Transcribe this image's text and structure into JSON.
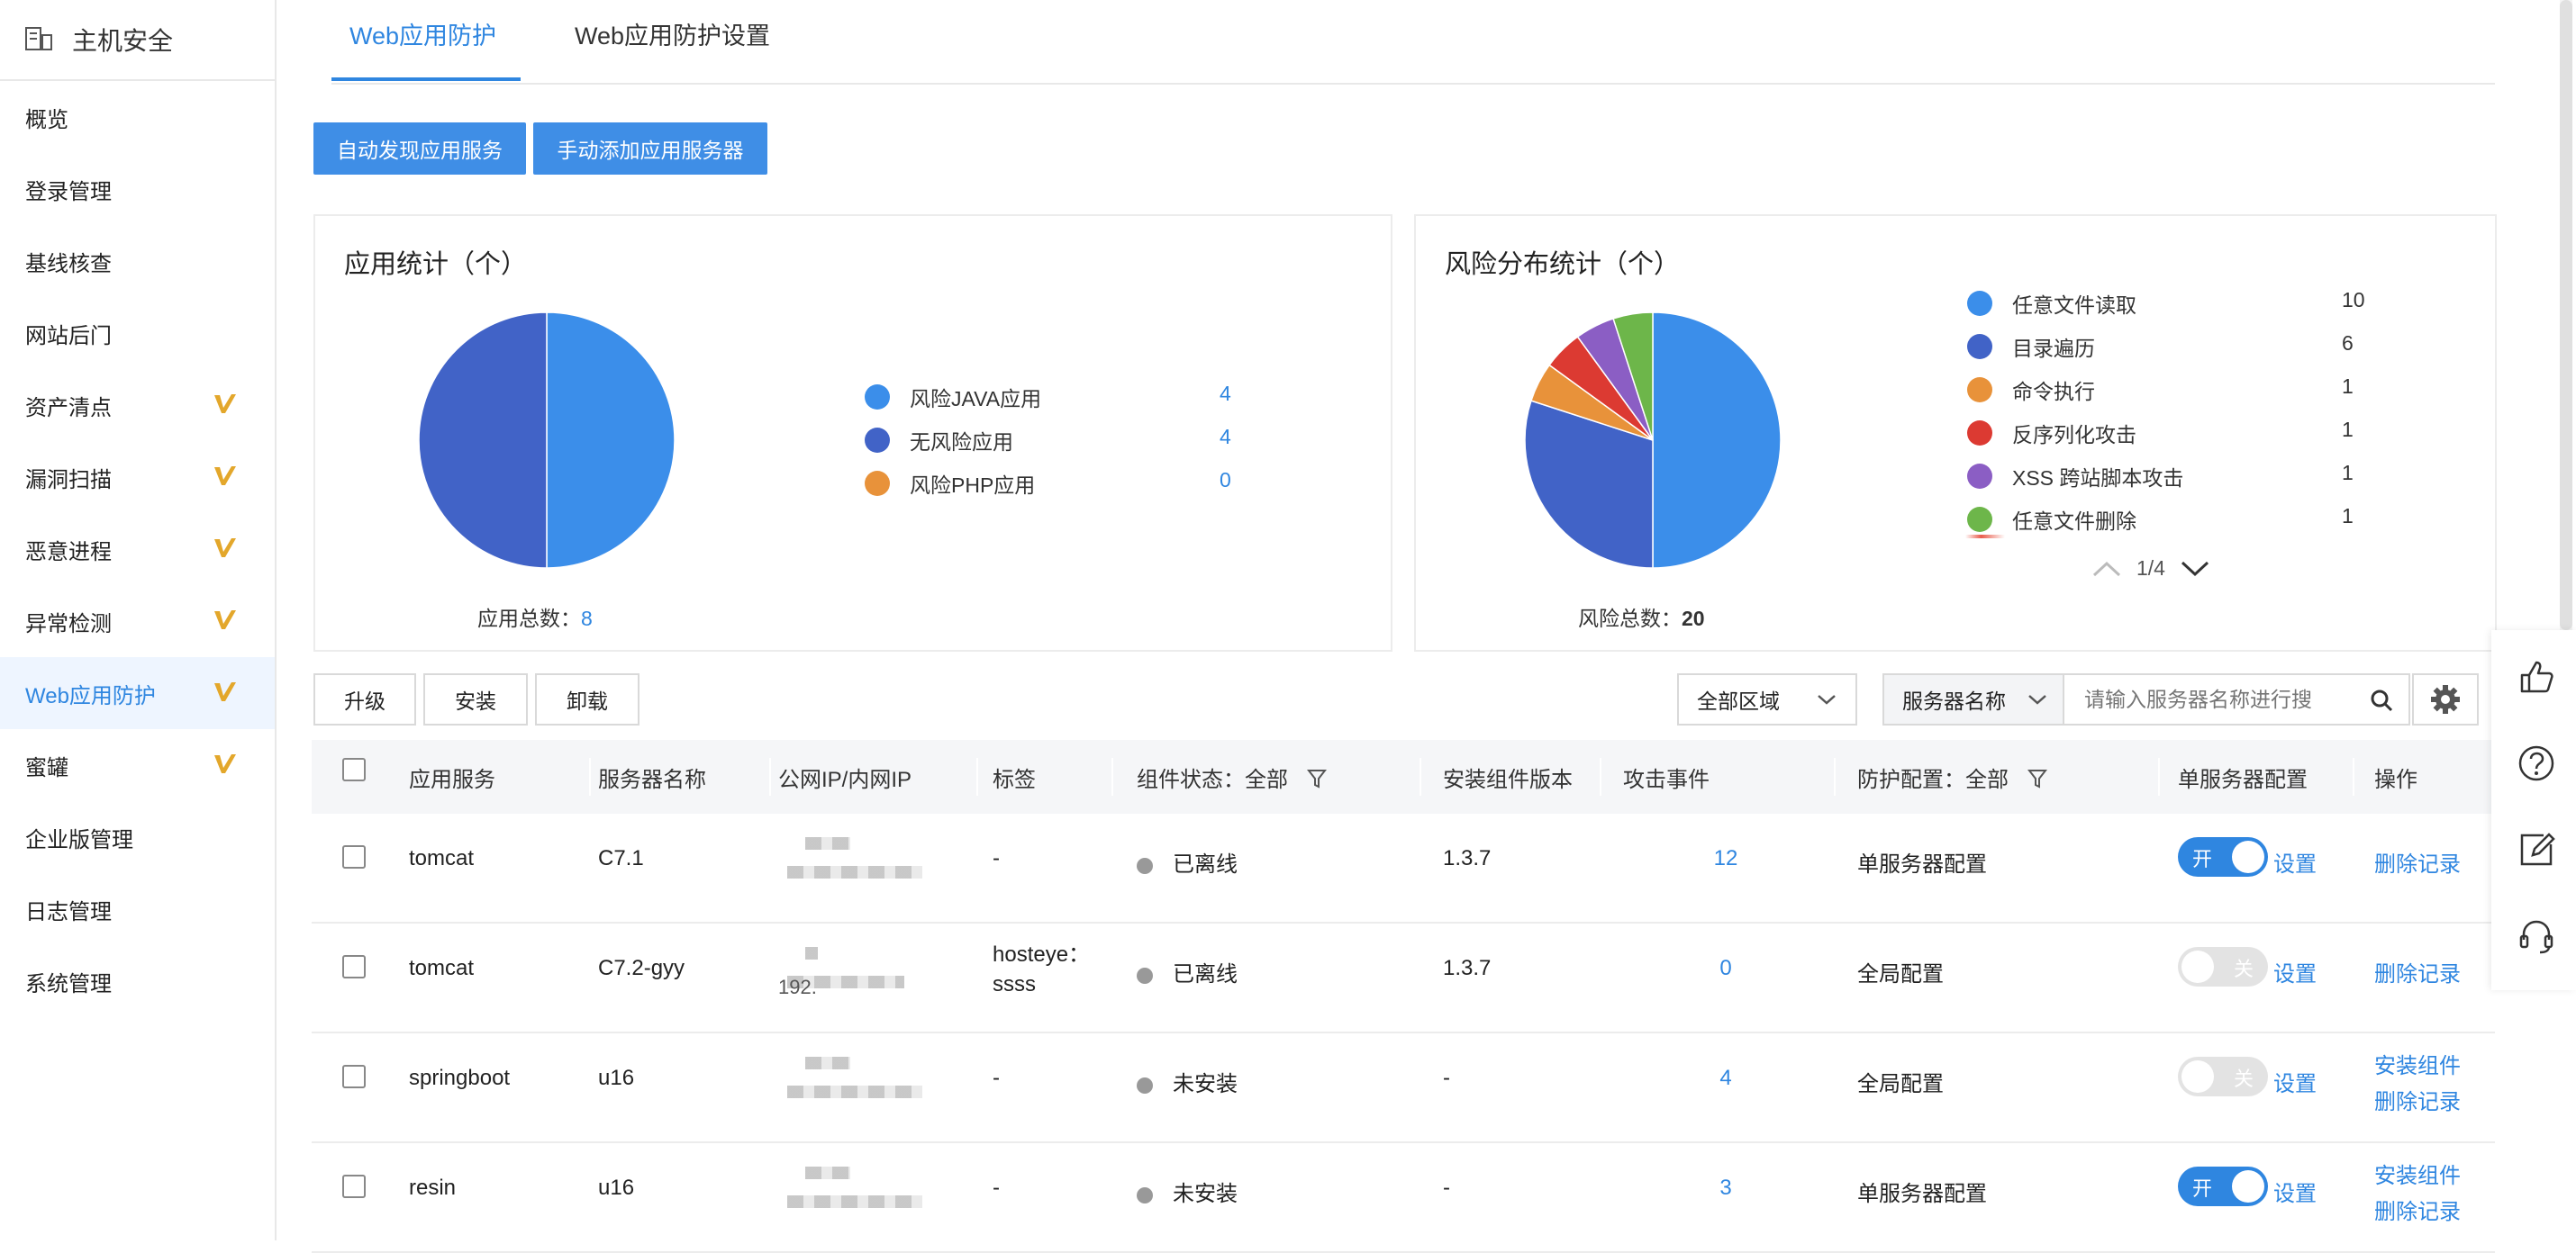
{
  "sidebar": {
    "title": "主机安全",
    "items": [
      {
        "label": "概览",
        "badge": false,
        "active": false
      },
      {
        "label": "登录管理",
        "badge": false,
        "active": false
      },
      {
        "label": "基线核查",
        "badge": false,
        "active": false
      },
      {
        "label": "网站后门",
        "badge": false,
        "active": false
      },
      {
        "label": "资产清点",
        "badge": true,
        "active": false
      },
      {
        "label": "漏洞扫描",
        "badge": true,
        "active": false
      },
      {
        "label": "恶意进程",
        "badge": true,
        "active": false
      },
      {
        "label": "异常检测",
        "badge": true,
        "active": false
      },
      {
        "label": "Web应用防护",
        "badge": true,
        "active": true
      },
      {
        "label": "蜜罐",
        "badge": true,
        "active": false
      },
      {
        "label": "企业版管理",
        "badge": false,
        "active": false
      },
      {
        "label": "日志管理",
        "badge": false,
        "active": false
      },
      {
        "label": "系统管理",
        "badge": false,
        "active": false
      }
    ]
  },
  "tabs": [
    "Web应用防护",
    "Web应用防护设置"
  ],
  "actions": {
    "auto_discover": "自动发现应用服务",
    "manual_add": "手动添加应用服务器"
  },
  "app_stats": {
    "title": "应用统计（个）",
    "total_label": "应用总数：",
    "total": "8",
    "legend": [
      {
        "label": "风险JAVA应用",
        "value": "4",
        "color": "#3b8eea"
      },
      {
        "label": "无风险应用",
        "value": "4",
        "color": "#4163c7"
      },
      {
        "label": "风险PHP应用",
        "value": "0",
        "color": "#e8923a"
      }
    ]
  },
  "risk_stats": {
    "title": "风险分布统计（个）",
    "total_label": "风险总数：",
    "total": "20",
    "legend": [
      {
        "label": "任意文件读取",
        "value": "10",
        "color": "#3b8eea"
      },
      {
        "label": "目录遍历",
        "value": "6",
        "color": "#4163c7"
      },
      {
        "label": "命令执行",
        "value": "1",
        "color": "#e8923a"
      },
      {
        "label": "反序列化攻击",
        "value": "1",
        "color": "#dc3a32"
      },
      {
        "label": "XSS 跨站脚本攻击",
        "value": "1",
        "color": "#8b5ec4"
      },
      {
        "label": "任意文件删除",
        "value": "1",
        "color": "#6db64a"
      }
    ],
    "page": "1/4"
  },
  "chart_data": [
    {
      "type": "pie",
      "title": "应用统计（个）",
      "categories": [
        "风险JAVA应用",
        "无风险应用",
        "风险PHP应用"
      ],
      "values": [
        4,
        4,
        0
      ],
      "colors": [
        "#3b8eea",
        "#4163c7",
        "#e8923a"
      ]
    },
    {
      "type": "pie",
      "title": "风险分布统计（个）",
      "categories": [
        "任意文件读取",
        "目录遍历",
        "命令执行",
        "反序列化攻击",
        "XSS 跨站脚本攻击",
        "任意文件删除"
      ],
      "values": [
        10,
        6,
        1,
        1,
        1,
        1
      ],
      "colors": [
        "#3b8eea",
        "#4163c7",
        "#e8923a",
        "#dc3a32",
        "#8b5ec4",
        "#6db64a"
      ]
    }
  ],
  "toolbar": {
    "upgrade": "升级",
    "install": "安装",
    "uninstall": "卸载",
    "region": "全部区域",
    "search_field": "服务器名称",
    "search_placeholder": "请输入服务器名称进行搜"
  },
  "table": {
    "headers": [
      "应用服务",
      "服务器名称",
      "公网IP/内网IP",
      "标签",
      "组件状态：全部",
      "安装组件版本",
      "攻击事件",
      "防护配置：全部",
      "单服务器配置",
      "操作"
    ],
    "rows": [
      {
        "service": "tomcat",
        "server": "C7.1",
        "ip_partial": "",
        "tag": "-",
        "tag2": "",
        "status": "已离线",
        "version": "1.3.7",
        "attacks": "12",
        "config": "单服务器配置",
        "toggle": "on",
        "toggle_label": "开",
        "set": "设置",
        "ops": [
          "删除记录"
        ]
      },
      {
        "service": "tomcat",
        "server": "C7.2-gyy",
        "ip_partial": "192.",
        "tag": "hosteye：",
        "tag2": "ssss",
        "status": "已离线",
        "version": "1.3.7",
        "attacks": "0",
        "config": "全局配置",
        "toggle": "off",
        "toggle_label": "关",
        "set": "设置",
        "ops": [
          "删除记录"
        ]
      },
      {
        "service": "springboot",
        "server": "u16",
        "ip_partial": "",
        "tag": "-",
        "tag2": "",
        "status": "未安装",
        "version": "-",
        "attacks": "4",
        "config": "全局配置",
        "toggle": "off",
        "toggle_label": "关",
        "set": "设置",
        "ops": [
          "安装组件",
          "删除记录"
        ]
      },
      {
        "service": "resin",
        "server": "u16",
        "ip_partial": "",
        "tag": "-",
        "tag2": "",
        "status": "未安装",
        "version": "-",
        "attacks": "3",
        "config": "单服务器配置",
        "toggle": "on",
        "toggle_label": "开",
        "set": "设置",
        "ops": [
          "安装组件",
          "删除记录"
        ]
      }
    ]
  }
}
